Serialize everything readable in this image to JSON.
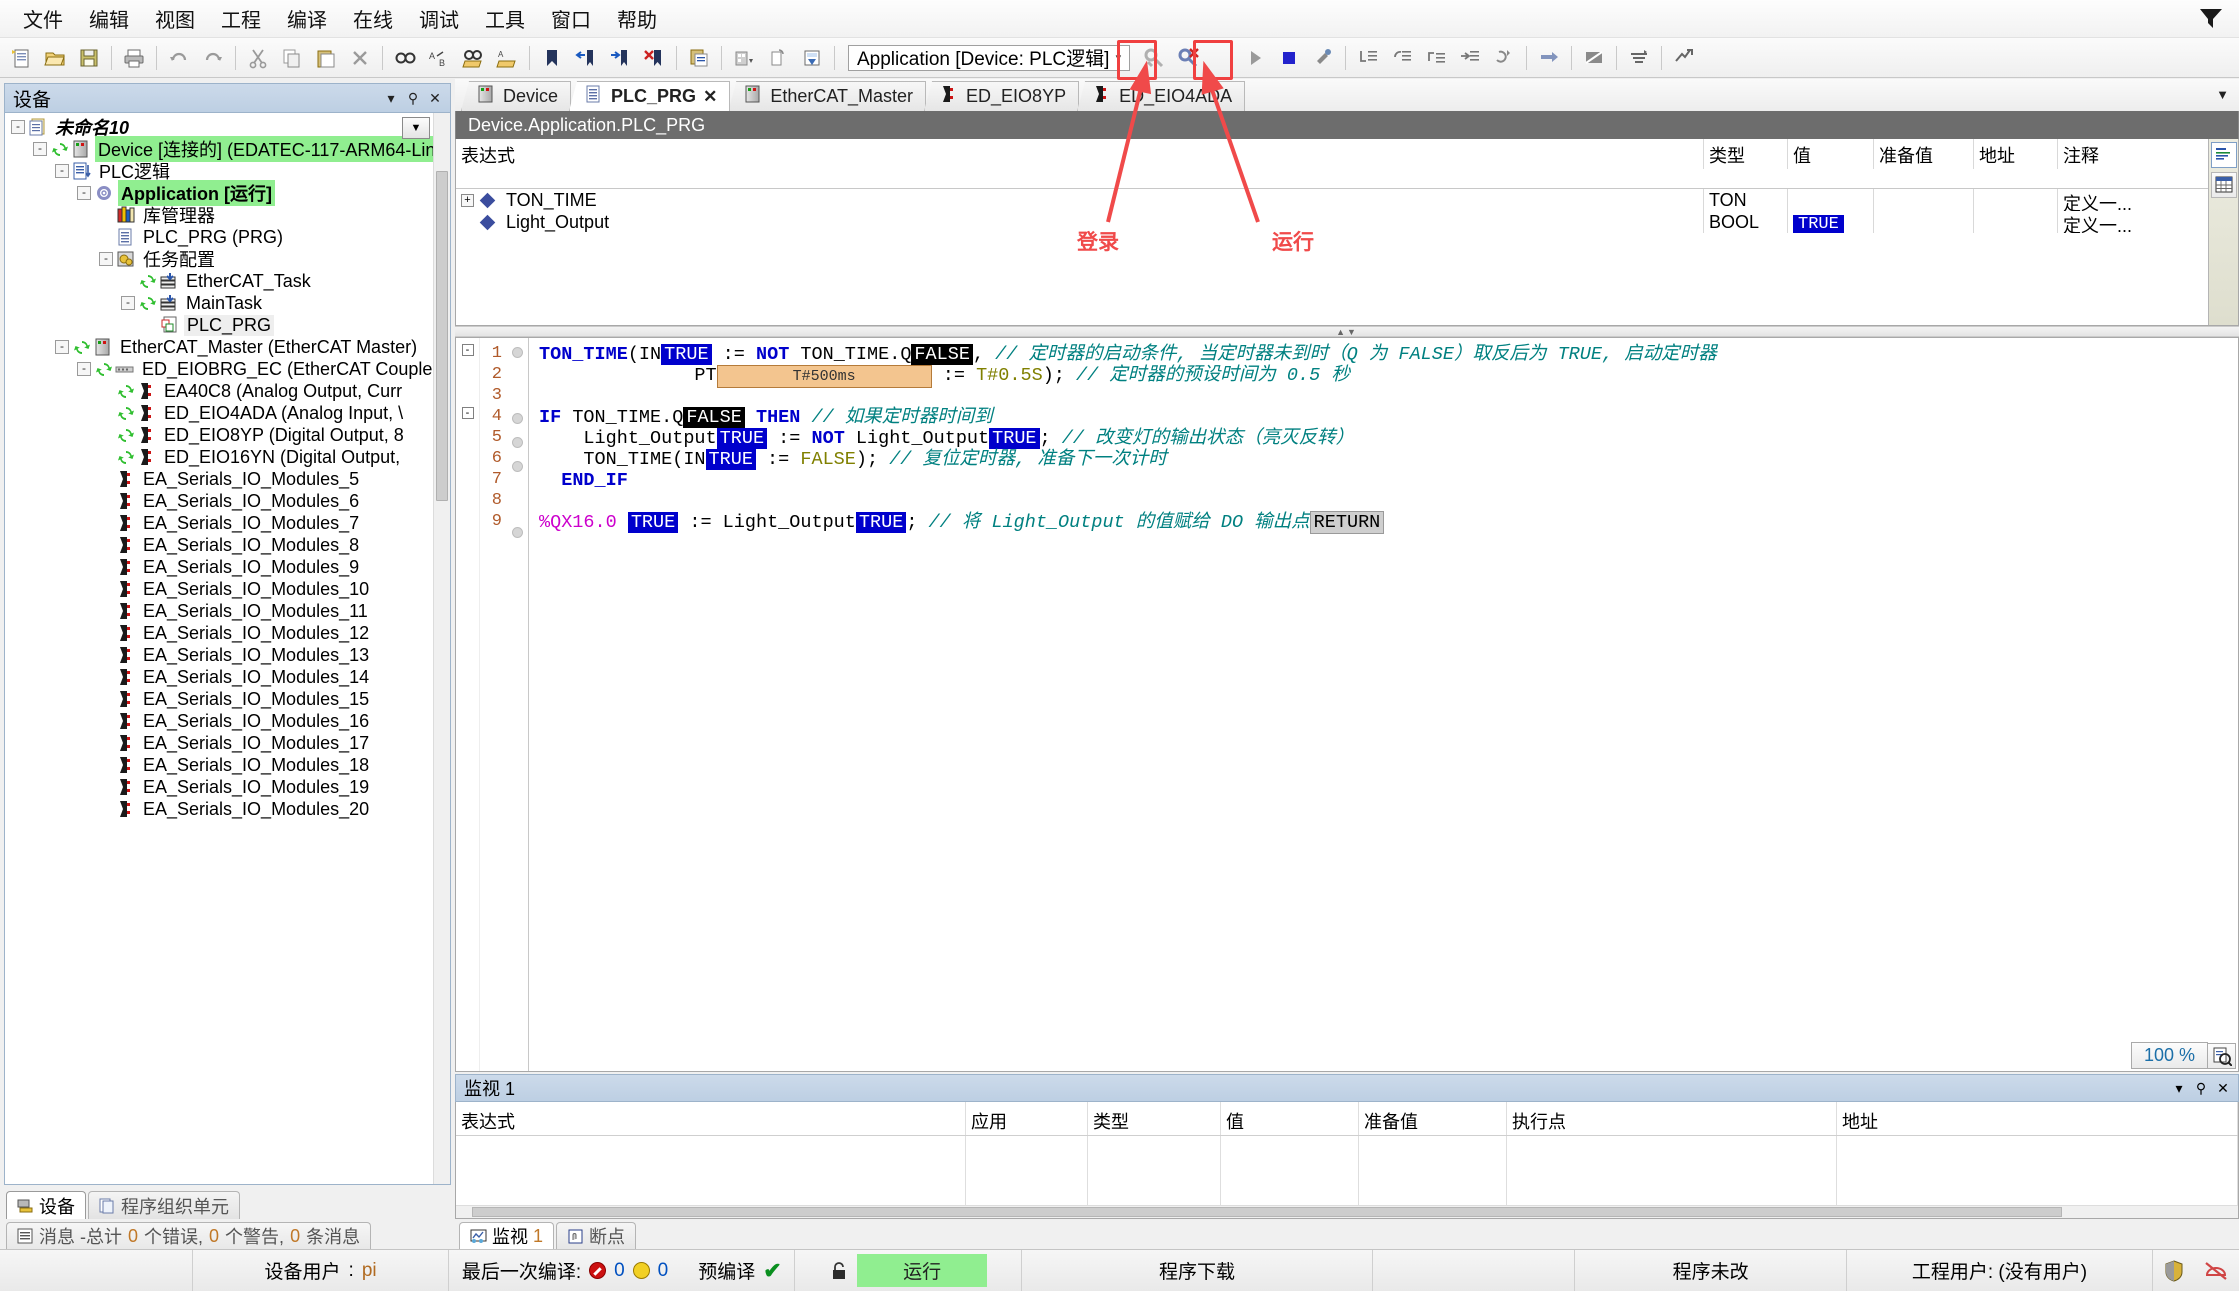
{
  "menubar": {
    "items": [
      "文件",
      "编辑",
      "视图",
      "工程",
      "编译",
      "在线",
      "调试",
      "工具",
      "窗口",
      "帮助"
    ],
    "filter_icon": "filter-icon"
  },
  "toolbar": {
    "buttons": [
      {
        "name": "new-file-icon"
      },
      {
        "name": "open-file-icon"
      },
      {
        "name": "save-icon"
      },
      {
        "name": "print-icon"
      },
      {
        "name": "undo-icon"
      },
      {
        "name": "redo-icon"
      },
      {
        "name": "cut-icon"
      },
      {
        "name": "copy-icon"
      },
      {
        "name": "paste-icon"
      },
      {
        "name": "delete-icon"
      },
      {
        "name": "find-icon"
      },
      {
        "name": "replace-icon"
      },
      {
        "name": "find-in-project-icon"
      },
      {
        "name": "replace-in-project-icon"
      },
      {
        "name": "bookmark-icon"
      },
      {
        "name": "previous-bookmark-icon"
      },
      {
        "name": "next-bookmark-icon"
      },
      {
        "name": "clear-bookmarks-icon"
      },
      {
        "name": "properties-icon"
      },
      {
        "name": "build-icon"
      },
      {
        "name": "generate-code-icon"
      },
      {
        "name": "clean-icon"
      },
      {
        "name": "login-icon"
      },
      {
        "name": "logout-icon"
      },
      {
        "name": "start-icon"
      },
      {
        "name": "stop-icon"
      },
      {
        "name": "reset-icon"
      },
      {
        "name": "step-into-icon"
      },
      {
        "name": "step-over-icon"
      },
      {
        "name": "step-out-icon"
      },
      {
        "name": "run-to-cursor-icon"
      },
      {
        "name": "set-next-statement-icon"
      },
      {
        "name": "next-statement-icon"
      },
      {
        "name": "toggle-breakpoint-icon"
      },
      {
        "name": "write-values-icon"
      },
      {
        "name": "force-values-icon"
      }
    ],
    "application_combo": {
      "value": "Application [Device: PLC逻辑]",
      "arrow": "▾"
    }
  },
  "annotations": [
    {
      "label": "登录",
      "name": "login-annotation"
    },
    {
      "label": "运行",
      "name": "run-annotation"
    }
  ],
  "devices_panel": {
    "title": "设备",
    "buttons": [
      "▾",
      "📌",
      "✕"
    ],
    "tree": [
      {
        "indent": 0,
        "label": "未命名10",
        "icon": "project-icon",
        "expander": "-",
        "style": "italic",
        "refresh": false
      },
      {
        "indent": 1,
        "label": "Device [连接的] (EDATEC-117-ARM64-Lin",
        "icon": "plc-device-icon",
        "expander": "-",
        "style": "green",
        "refresh": true
      },
      {
        "indent": 2,
        "label": "PLC逻辑",
        "icon": "plc-logic-icon",
        "expander": "-",
        "style": "",
        "refresh": false
      },
      {
        "indent": 3,
        "label": "Application [运行]",
        "icon": "application-icon",
        "expander": "-",
        "style": "green-bold",
        "refresh": false
      },
      {
        "indent": 4,
        "label": "库管理器",
        "icon": "library-manager-icon",
        "expander": "",
        "style": "",
        "refresh": false
      },
      {
        "indent": 4,
        "label": "PLC_PRG (PRG)",
        "icon": "pou-icon",
        "expander": "",
        "style": "",
        "refresh": false
      },
      {
        "indent": 4,
        "label": "任务配置",
        "icon": "task-config-icon",
        "expander": "-",
        "style": "",
        "refresh": false
      },
      {
        "indent": 5,
        "label": "EtherCAT_Task",
        "icon": "task-icon",
        "expander": "",
        "style": "",
        "refresh": true
      },
      {
        "indent": 5,
        "label": "MainTask",
        "icon": "task-icon",
        "expander": "-",
        "style": "",
        "refresh": true
      },
      {
        "indent": 6,
        "label": "PLC_PRG",
        "icon": "program-ref-icon",
        "expander": "",
        "style": "selected",
        "refresh": false
      },
      {
        "indent": 2,
        "label": "EtherCAT_Master (EtherCAT Master)",
        "icon": "plc-device-icon",
        "expander": "-",
        "style": "",
        "refresh": true
      },
      {
        "indent": 3,
        "label": "ED_EIOBRG_EC (EtherCAT Couple",
        "icon": "bus-coupler-icon",
        "expander": "-",
        "style": "",
        "refresh": true
      },
      {
        "indent": 4,
        "label": "EA40C8 (Analog Output, Curr",
        "icon": "io-module-icon",
        "expander": "",
        "style": "",
        "refresh": true
      },
      {
        "indent": 4,
        "label": "ED_EIO4ADA (Analog Input, \\",
        "icon": "io-module-icon",
        "expander": "",
        "style": "",
        "refresh": true
      },
      {
        "indent": 4,
        "label": "ED_EIO8YP (Digital Output, 8",
        "icon": "io-module-icon",
        "expander": "",
        "style": "",
        "refresh": true
      },
      {
        "indent": 4,
        "label": "ED_EIO16YN (Digital Output,",
        "icon": "io-module-icon",
        "expander": "",
        "style": "",
        "refresh": true
      },
      {
        "indent": 4,
        "label": "EA_Serials_IO_Modules_5",
        "icon": "io-module-icon",
        "expander": "",
        "style": "",
        "refresh": false
      },
      {
        "indent": 4,
        "label": "EA_Serials_IO_Modules_6",
        "icon": "io-module-icon",
        "expander": "",
        "style": "",
        "refresh": false
      },
      {
        "indent": 4,
        "label": "EA_Serials_IO_Modules_7",
        "icon": "io-module-icon",
        "expander": "",
        "style": "",
        "refresh": false
      },
      {
        "indent": 4,
        "label": "EA_Serials_IO_Modules_8",
        "icon": "io-module-icon",
        "expander": "",
        "style": "",
        "refresh": false
      },
      {
        "indent": 4,
        "label": "EA_Serials_IO_Modules_9",
        "icon": "io-module-icon",
        "expander": "",
        "style": "",
        "refresh": false
      },
      {
        "indent": 4,
        "label": "EA_Serials_IO_Modules_10",
        "icon": "io-module-icon",
        "expander": "",
        "style": "",
        "refresh": false
      },
      {
        "indent": 4,
        "label": "EA_Serials_IO_Modules_11",
        "icon": "io-module-icon",
        "expander": "",
        "style": "",
        "refresh": false
      },
      {
        "indent": 4,
        "label": "EA_Serials_IO_Modules_12",
        "icon": "io-module-icon",
        "expander": "",
        "style": "",
        "refresh": false
      },
      {
        "indent": 4,
        "label": "EA_Serials_IO_Modules_13",
        "icon": "io-module-icon",
        "expander": "",
        "style": "",
        "refresh": false
      },
      {
        "indent": 4,
        "label": "EA_Serials_IO_Modules_14",
        "icon": "io-module-icon",
        "expander": "",
        "style": "",
        "refresh": false
      },
      {
        "indent": 4,
        "label": "EA_Serials_IO_Modules_15",
        "icon": "io-module-icon",
        "expander": "",
        "style": "",
        "refresh": false
      },
      {
        "indent": 4,
        "label": "EA_Serials_IO_Modules_16",
        "icon": "io-module-icon",
        "expander": "",
        "style": "",
        "refresh": false
      },
      {
        "indent": 4,
        "label": "EA_Serials_IO_Modules_17",
        "icon": "io-module-icon",
        "expander": "",
        "style": "",
        "refresh": false
      },
      {
        "indent": 4,
        "label": "EA_Serials_IO_Modules_18",
        "icon": "io-module-icon",
        "expander": "",
        "style": "",
        "refresh": false
      },
      {
        "indent": 4,
        "label": "EA_Serials_IO_Modules_19",
        "icon": "io-module-icon",
        "expander": "",
        "style": "",
        "refresh": false
      },
      {
        "indent": 4,
        "label": "EA_Serials_IO_Modules_20",
        "icon": "io-module-icon",
        "expander": "",
        "style": "",
        "refresh": false
      }
    ],
    "tabs": [
      {
        "label": "设备",
        "icon": "devices-icon",
        "active": true
      },
      {
        "label": "程序组织单元",
        "icon": "pou-tree-icon",
        "active": false
      }
    ],
    "message_tab": {
      "icon": "messages-icon",
      "label": "消息 -总计",
      "errors": "0",
      "errors_suffix": "个错误,",
      "warnings": "0",
      "warnings_suffix": "个警告,",
      "messages": "0",
      "messages_suffix": "条消息"
    }
  },
  "editor": {
    "doc_tabs": [
      {
        "label": "Device",
        "icon": "plc-device-icon",
        "active": false,
        "closable": false
      },
      {
        "label": "PLC_PRG",
        "icon": "pou-icon",
        "active": true,
        "closable": true,
        "close": "✕"
      },
      {
        "label": "EtherCAT_Master",
        "icon": "plc-device-icon",
        "active": false,
        "closable": false
      },
      {
        "label": "ED_EIO8YP",
        "icon": "io-module-icon",
        "active": false,
        "closable": false
      },
      {
        "label": "ED_EIO4ADA",
        "icon": "io-module-icon",
        "active": false,
        "closable": false
      }
    ],
    "header": "Device.Application.PLC_PRG",
    "var_table": {
      "columns": [
        "表达式",
        "类型",
        "值",
        "准备值",
        "地址",
        "注释"
      ],
      "rows": [
        {
          "expr": "TON_TIME",
          "expandable": true,
          "type": "TON",
          "value": "",
          "value_hl": false,
          "prepared": "",
          "address": "",
          "comment": "定义一..."
        },
        {
          "expr": "Light_Output",
          "expandable": false,
          "type": "BOOL",
          "value": "TRUE",
          "value_hl": true,
          "prepared": "",
          "address": "",
          "comment": "定义一..."
        }
      ]
    },
    "code": {
      "zoom": "100 %",
      "lines": [
        {
          "no": "1",
          "fold": "-",
          "bp": true,
          "html": "<span class=\"kw\">TON_TIME</span>(IN<span class=\"inl-true\">TRUE</span> := <span class=\"kw\">NOT</span> TON_TIME.Q<span class=\"inl-false\">FALSE</span>, <span class=\"com\">// 定时器的启动条件, 当定时器未到时（Q 为 FALSE）取反后为 TRUE, 启动定时器</span>"
        },
        {
          "no": "2",
          "fold": "",
          "bp": false,
          "html": "              PT<span class=\"pt-box\">T#500ms</span> := <span class=\"lit\">T#0.5S</span>); <span class=\"com\">// 定时器的预设时间为 0.5 秒</span>"
        },
        {
          "no": "3",
          "fold": "",
          "bp": false,
          "html": ""
        },
        {
          "no": "4",
          "fold": "-",
          "bp": true,
          "html": "<span class=\"kw\">IF</span> TON_TIME.Q<span class=\"inl-false\">FALSE</span> <span class=\"kw\">THEN</span> <span class=\"com\">// 如果定时器时间到</span>"
        },
        {
          "no": "5",
          "fold": "",
          "bp": true,
          "html": "    Light_Output<span class=\"inl-true\">TRUE</span> := <span class=\"kw\">NOT</span> Light_Output<span class=\"inl-true\">TRUE</span>; <span class=\"com\">// 改变灯的输出状态（亮灭反转）</span>"
        },
        {
          "no": "6",
          "fold": "",
          "bp": true,
          "html": "    TON_TIME(IN<span class=\"inl-true\">TRUE</span> := <span class=\"lit\">FALSE</span>); <span class=\"com\">// 复位定时器, 准备下一次计时</span>"
        },
        {
          "no": "7",
          "fold": "",
          "bp": false,
          "html": "  <span class=\"kw\">END_IF</span>"
        },
        {
          "no": "8",
          "fold": "",
          "bp": false,
          "html": ""
        },
        {
          "no": "9",
          "fold": "",
          "bp": true,
          "html": "<span class=\"addrv\">%QX16.0</span> <span class=\"inl-true\">TRUE</span> := Light_Output<span class=\"inl-true\">TRUE</span>; <span class=\"com\">// 将 Light_Output 的值赋给 DO 输出点</span><span class=\"inl-ret\">RETURN</span>"
        }
      ]
    }
  },
  "watch_panel": {
    "title": "监视 1",
    "buttons": [
      "▾",
      "📌",
      "✕"
    ],
    "columns": [
      "表达式",
      "应用",
      "类型",
      "值",
      "准备值",
      "执行点",
      "地址"
    ],
    "rows": [],
    "tabs": [
      {
        "label": "监视",
        "num": "1",
        "icon": "watch-icon",
        "active": true
      },
      {
        "label": "断点",
        "num": "",
        "icon": "breakpoint-icon",
        "active": false
      }
    ]
  },
  "statusbar": {
    "device_user_label": "设备用户",
    "device_user_value": "pi",
    "last_build_label": "最后一次编译:",
    "last_build_errors": "0",
    "last_build_warnings": "0",
    "precompile_label": "预编译",
    "precompile_check": "✔",
    "lock_icon": "lock-icon",
    "run_state": "运行",
    "download_state": "程序下载",
    "modify_state": "程序未改",
    "project_user": "工程用户: (没有用户)",
    "right_icons": [
      "shield-icon",
      "no-connection-icon"
    ]
  }
}
